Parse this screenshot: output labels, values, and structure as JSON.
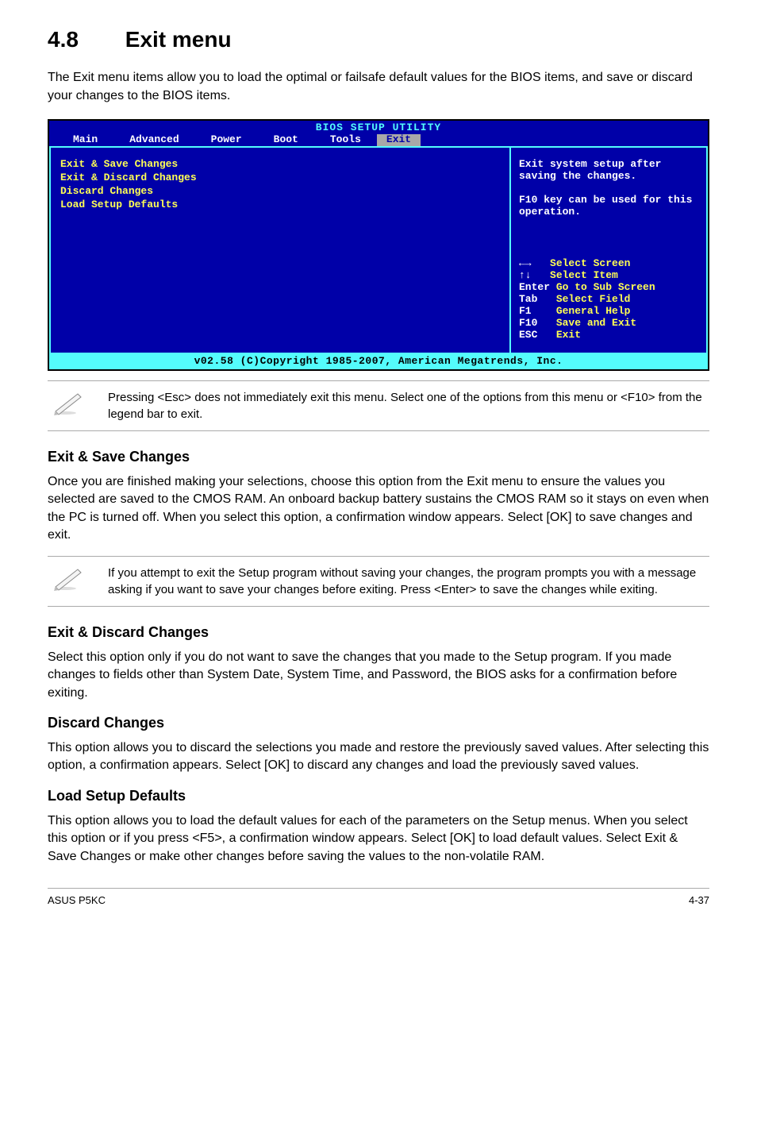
{
  "section": {
    "number": "4.8",
    "title": "Exit menu"
  },
  "intro": "The Exit menu items allow you to load the optimal or failsafe default values for the BIOS items, and save or discard your changes to the BIOS items.",
  "bios": {
    "title": "BIOS SETUP UTILITY",
    "tabs": [
      "Main",
      "Advanced",
      "Power",
      "Boot",
      "Tools",
      "Exit"
    ],
    "active_tab": "Exit",
    "menu_items": [
      "Exit & Save Changes",
      "Exit & Discard Changes",
      "Discard Changes",
      "",
      "Load Setup Defaults"
    ],
    "help_top": "Exit system setup after saving the changes.\n\nF10 key can be used for this operation.",
    "legend": [
      {
        "key": "←→",
        "desc": "Select Screen"
      },
      {
        "key": "↑↓",
        "desc": "Select Item"
      },
      {
        "key": "Enter",
        "desc": "Go to Sub Screen"
      },
      {
        "key": "Tab",
        "desc": "Select Field"
      },
      {
        "key": "F1",
        "desc": "General Help"
      },
      {
        "key": "F10",
        "desc": "Save and Exit"
      },
      {
        "key": "ESC",
        "desc": "Exit"
      }
    ],
    "footer": "v02.58 (C)Copyright 1985-2007, American Megatrends, Inc."
  },
  "note1": "Pressing <Esc> does not immediately exit this menu. Select one of the options from this menu or <F10> from the legend bar to exit.",
  "sections": {
    "save": {
      "heading": "Exit & Save Changes",
      "body": "Once you are finished making your selections, choose this option from the Exit menu to ensure the values you selected are saved to the CMOS RAM. An onboard backup battery sustains the CMOS RAM so it stays on even when the PC is turned off. When you select this option, a confirmation window appears. Select [OK] to save changes and exit."
    },
    "save_note": " If you attempt to exit the Setup program without saving your changes, the program prompts you with a message asking if you want to save your changes before exiting. Press <Enter>  to save the  changes while exiting.",
    "discard_exit": {
      "heading": "Exit & Discard Changes",
      "body": "Select this option only if you do not want to save the changes that you  made to the Setup program. If you made changes to fields other than System Date, System Time, and Password, the BIOS asks for a confirmation before exiting."
    },
    "discard": {
      "heading": "Discard Changes",
      "body": "This option allows you to discard the selections you made and restore the previously saved values. After selecting this option, a confirmation appears. Select [OK] to discard any changes and load the previously saved values."
    },
    "defaults": {
      "heading": "Load Setup Defaults",
      "body": "This option allows you to load the default values for each of the parameters on the Setup menus. When you select this option or if you press <F5>, a confirmation window appears. Select [OK] to load default values. Select Exit & Save Changes or make other changes before saving the values to the non-volatile RAM."
    }
  },
  "footer": {
    "left": "ASUS P5KC",
    "right": "4-37"
  }
}
